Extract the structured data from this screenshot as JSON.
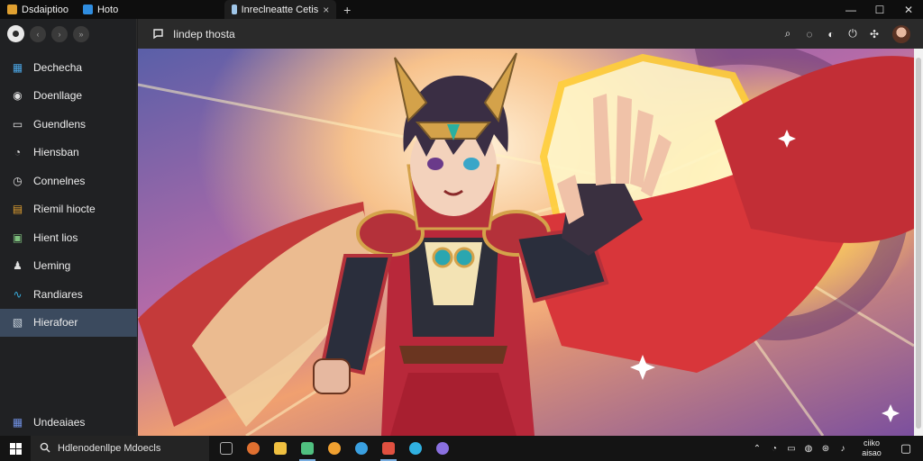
{
  "tabs": [
    {
      "title": "Dsdaiptioo",
      "favicon_color": "#e0a030"
    },
    {
      "title": "Hoto",
      "favicon_color": "#2f8de0"
    },
    {
      "title": "Inreclneatte Cetis",
      "favicon_color": "#9fc6e8",
      "close": "×"
    }
  ],
  "new_tab_symbol": "+",
  "window_controls": {
    "minimize": "—",
    "maximize": "☐",
    "close": "✕"
  },
  "sidebar": {
    "top_nav": [
      "‹",
      "›",
      "»"
    ],
    "items": [
      {
        "label": "Dechecha",
        "icon": "chart-icon",
        "glyph": "▦",
        "color": "#4aa3e0"
      },
      {
        "label": "Doenllage",
        "icon": "user-circle-icon",
        "glyph": "◉",
        "color": "#e0e0e0"
      },
      {
        "label": "Guendlens",
        "icon": "window-icon",
        "glyph": "▭",
        "color": "#e0e0e0"
      },
      {
        "label": "Hiensban",
        "icon": "chat-icon",
        "glyph": "◔",
        "color": "#e0e0e0"
      },
      {
        "label": "Connelnes",
        "icon": "clock-icon",
        "glyph": "◷",
        "color": "#e0e0e0"
      },
      {
        "label": "Riemil hiocte",
        "icon": "folder-icon",
        "glyph": "▤",
        "color": "#e0a030"
      },
      {
        "label": "Hient lios",
        "icon": "image-icon",
        "glyph": "▣",
        "color": "#7ec07e"
      },
      {
        "label": "Ueming",
        "icon": "person-icon",
        "glyph": "♟",
        "color": "#e0e0e0"
      },
      {
        "label": "Randiares",
        "icon": "link-icon",
        "glyph": "∿",
        "color": "#3ab0e0"
      },
      {
        "label": "Hierafoer",
        "icon": "gallery-icon",
        "glyph": "▧",
        "color": "#cfd8e0",
        "active": true
      }
    ],
    "bottom_item": {
      "label": "Undeaiaes",
      "icon": "apps-icon",
      "glyph": "▦",
      "color": "#6f8fe0"
    }
  },
  "header": {
    "title": "Iindep thosta",
    "icons": [
      "search-icon",
      "chat-icon",
      "camera-icon",
      "power-icon",
      "settings-icon"
    ],
    "glyphs": [
      "⌕",
      "◌",
      "◐",
      "⏻",
      "✣"
    ]
  },
  "taskbar": {
    "search_text": "Hdlenodenllpe Mdoecls",
    "apps": [
      {
        "icon": "taskview-icon",
        "color": "#b0b0b0"
      },
      {
        "icon": "browser-icon",
        "color": "#e07030"
      },
      {
        "icon": "folder-icon",
        "color": "#f0c040"
      },
      {
        "icon": "files-icon",
        "color": "#50c080"
      },
      {
        "icon": "mail-icon",
        "color": "#f0a030"
      },
      {
        "icon": "globe-icon",
        "color": "#3aa0e0"
      },
      {
        "icon": "media-icon",
        "color": "#e05040"
      },
      {
        "icon": "edge-icon",
        "color": "#30b0e0"
      },
      {
        "icon": "discord-icon",
        "color": "#8a70e0"
      }
    ],
    "tray_glyphs": [
      "⌃",
      "◔",
      "▭",
      "◍",
      "⊛",
      "♪"
    ],
    "clock": {
      "time": "ciiko",
      "date": "aisao"
    },
    "notification_glyph": "▢"
  },
  "colors": {
    "accent": "#3b4a5e",
    "sidebar_bg": "#202123",
    "header_bg": "#2a2a2a"
  }
}
